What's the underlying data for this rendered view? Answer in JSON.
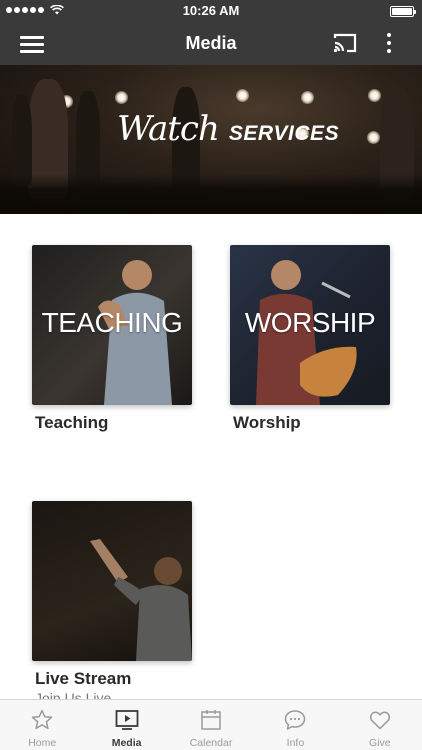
{
  "status_bar": {
    "time": "10:26 AM"
  },
  "nav": {
    "title": "Media"
  },
  "hero": {
    "script_word": "Watch",
    "caps_word": "SERVICES"
  },
  "cards": [
    {
      "overlay": "TEACHING",
      "label": "Teaching"
    },
    {
      "overlay": "WORSHIP",
      "label": "Worship"
    },
    {
      "label": "Live Stream",
      "subtitle": "Join Us Live"
    }
  ],
  "tabs": [
    {
      "label": "Home",
      "icon": "star-icon"
    },
    {
      "label": "Media",
      "icon": "play-screen-icon",
      "active": true
    },
    {
      "label": "Calendar",
      "icon": "calendar-icon"
    },
    {
      "label": "Info",
      "icon": "chat-bubble-icon"
    },
    {
      "label": "Give",
      "icon": "heart-icon"
    }
  ],
  "colors": {
    "bar": "#3a3a3a",
    "tab_inactive": "#9a9a9a",
    "tab_active": "#3a3a3a"
  }
}
